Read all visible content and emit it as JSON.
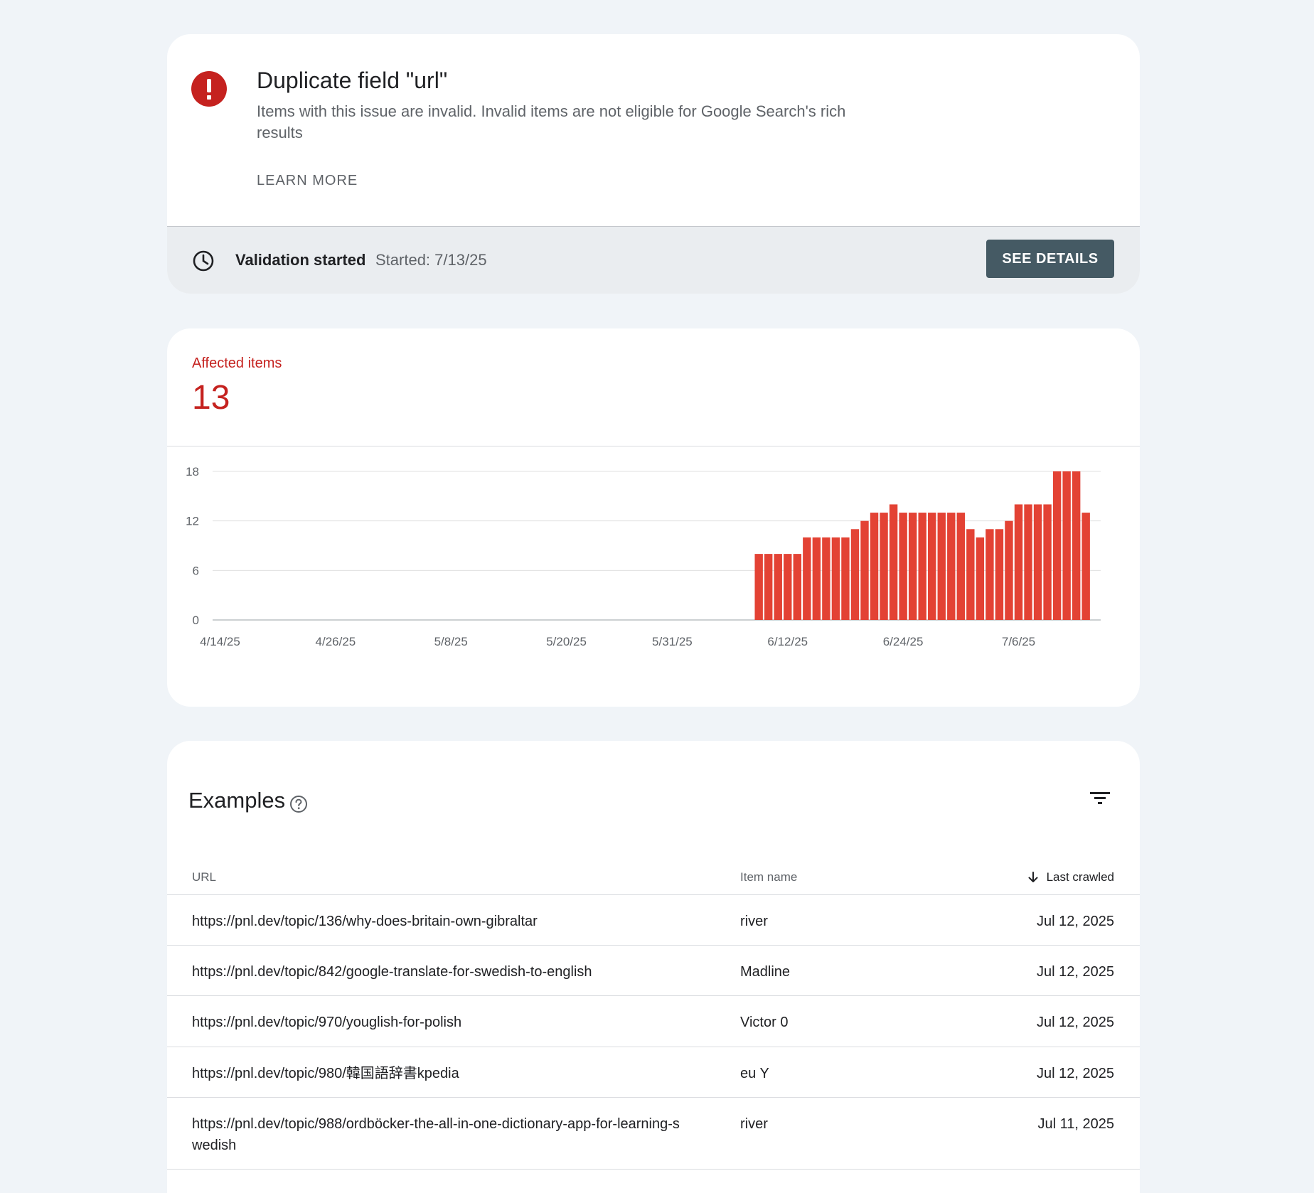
{
  "issue": {
    "title": "Duplicate field \"url\"",
    "description": "Items with this issue are invalid. Invalid items are not eligible for Google Search's rich results",
    "learn_more_label": "LEARN MORE",
    "icon": "error-icon",
    "color": "#c5221f"
  },
  "validation": {
    "status_label": "Validation started",
    "started_text": "Started: 7/13/25",
    "button_label": "SEE DETAILS",
    "button_color": "#455a64",
    "icon": "clock-icon"
  },
  "affected": {
    "label": "Affected items",
    "value": "13",
    "color": "#c5221f"
  },
  "chart_data": {
    "type": "bar",
    "color": "#e34234",
    "ylim": [
      0,
      18
    ],
    "y_ticks": [
      0,
      6,
      12,
      18
    ],
    "x_tick_labels": [
      "4/14/25",
      "4/26/25",
      "5/8/25",
      "5/20/25",
      "5/31/25",
      "6/12/25",
      "6/24/25",
      "7/6/25"
    ],
    "first_date": "4/14/25",
    "values": [
      0,
      0,
      0,
      0,
      0,
      0,
      0,
      0,
      0,
      0,
      0,
      0,
      0,
      0,
      0,
      0,
      0,
      0,
      0,
      0,
      0,
      0,
      0,
      0,
      0,
      0,
      0,
      0,
      0,
      0,
      0,
      0,
      0,
      0,
      0,
      0,
      0,
      0,
      0,
      0,
      0,
      0,
      0,
      0,
      0,
      0,
      0,
      0,
      0,
      0,
      0,
      0,
      0,
      0,
      0,
      0,
      8,
      8,
      8,
      8,
      8,
      10,
      10,
      10,
      10,
      10,
      11,
      12,
      13,
      13,
      14,
      13,
      13,
      13,
      13,
      13,
      13,
      13,
      11,
      10,
      11,
      11,
      12,
      14,
      14,
      14,
      14,
      18,
      18,
      18,
      13
    ],
    "grid": true
  },
  "examples": {
    "title": "Examples",
    "help_icon": "help-icon",
    "filter_icon": "filter-icon",
    "columns": {
      "url": "URL",
      "item_name": "Item name",
      "last_crawled": "Last crawled",
      "sort_icon": "arrow-down-icon"
    },
    "rows": [
      {
        "url": "https://pnl.dev/topic/136/why-does-britain-own-gibraltar",
        "item_name": "river",
        "last_crawled": "Jul 12, 2025"
      },
      {
        "url": "https://pnl.dev/topic/842/google-translate-for-swedish-to-english",
        "item_name": "Madline",
        "last_crawled": "Jul 12, 2025"
      },
      {
        "url": "https://pnl.dev/topic/970/youglish-for-polish",
        "item_name": "Victor 0",
        "last_crawled": "Jul 12, 2025"
      },
      {
        "url": "https://pnl.dev/topic/980/韓国語辞書kpedia",
        "item_name": "eu Y",
        "last_crawled": "Jul 12, 2025"
      },
      {
        "url": "https://pnl.dev/topic/988/ordböcker-the-all-in-one-dictionary-app-for-learning-swedish",
        "item_name": "river",
        "last_crawled": "Jul 11, 2025"
      }
    ]
  }
}
